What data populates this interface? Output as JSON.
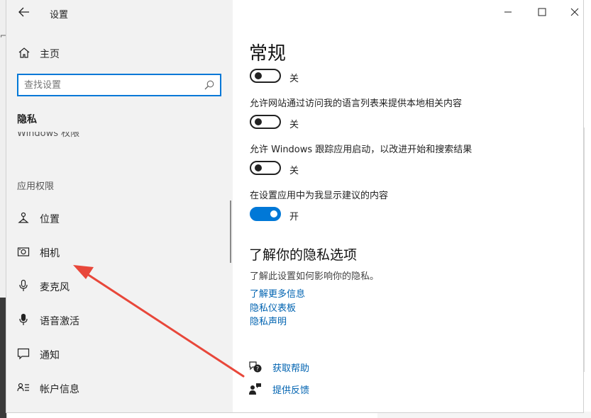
{
  "titlebar": {
    "title": "设置",
    "back_icon": "back-arrow-icon",
    "minimize": "minimize-icon",
    "maximize": "maximize-icon",
    "close": "close-icon"
  },
  "sidebar": {
    "home_label": "主页",
    "search_placeholder": "查找设置",
    "section_title": "隐私",
    "partial_item": "Windows 权限",
    "group_header": "应用权限",
    "items": [
      {
        "label": "位置",
        "icon": "location-icon"
      },
      {
        "label": "相机",
        "icon": "camera-icon"
      },
      {
        "label": "麦克风",
        "icon": "microphone-icon"
      },
      {
        "label": "语音激活",
        "icon": "voice-activation-icon"
      },
      {
        "label": "通知",
        "icon": "notification-icon"
      },
      {
        "label": "帐户信息",
        "icon": "account-info-icon"
      }
    ]
  },
  "content": {
    "heading": "常规",
    "toggles": [
      {
        "text": "",
        "state": "关",
        "on": false
      },
      {
        "text": "允许网站通过访问我的语言列表来提供本地相关内容",
        "state": "关",
        "on": false
      },
      {
        "text": "允许 Windows 跟踪应用启动，以改进开始和搜索结果",
        "state": "关",
        "on": false
      },
      {
        "text": "在设置应用中为我显示建议的内容",
        "state": "开",
        "on": true
      }
    ],
    "learn": {
      "heading": "了解你的隐私选项",
      "description": "了解此设置如何影响你的隐私。",
      "links": [
        "了解更多信息",
        "隐私仪表板",
        "隐私声明"
      ]
    },
    "help": {
      "get_help": "获取帮助",
      "feedback": "提供反馈"
    }
  },
  "colors": {
    "accent": "#0078d7",
    "link": "#0063b1",
    "annotation_arrow": "#e8473a",
    "sidebar_bg": "#f2f2f2"
  }
}
